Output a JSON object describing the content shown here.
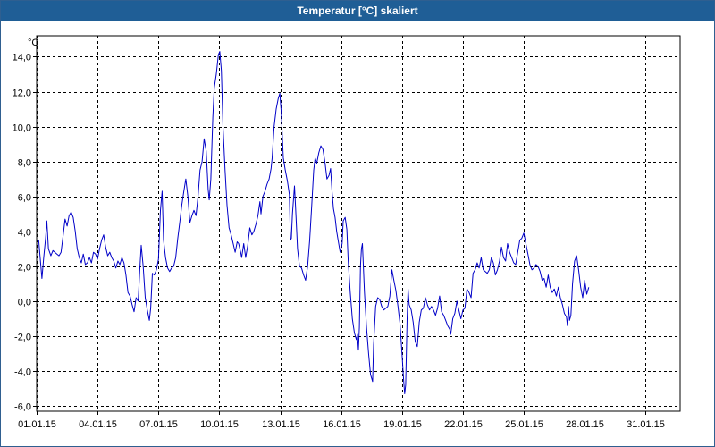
{
  "window": {
    "title": "Temperatur [°C] skaliert"
  },
  "colors": {
    "titlebar": "#1f5e96",
    "series": "#0000c8",
    "grid": "#000000",
    "background": "#ffffff"
  },
  "chart_data": {
    "type": "line",
    "title": "Temperatur [°C] skaliert",
    "ylabel": "°C",
    "xlabel": "",
    "grid": true,
    "legend": "none",
    "xlim": [
      0,
      31.7
    ],
    "ylim": [
      -6.3,
      15.2
    ],
    "x_ticks": [
      {
        "x": 0,
        "label": "01.01.15"
      },
      {
        "x": 3,
        "label": "04.01.15"
      },
      {
        "x": 6,
        "label": "07.01.15"
      },
      {
        "x": 9,
        "label": "10.01.15"
      },
      {
        "x": 12,
        "label": "13.01.15"
      },
      {
        "x": 15,
        "label": "16.01.15"
      },
      {
        "x": 18,
        "label": "19.01.15"
      },
      {
        "x": 21,
        "label": "22.01.15"
      },
      {
        "x": 24,
        "label": "25.01.15"
      },
      {
        "x": 27,
        "label": "28.01.15"
      },
      {
        "x": 30,
        "label": "31.01.15"
      }
    ],
    "y_ticks": [
      {
        "y": -6,
        "label": "-6,0"
      },
      {
        "y": -4,
        "label": "-4,0"
      },
      {
        "y": -2,
        "label": "-2,0"
      },
      {
        "y": 0,
        "label": "0,0"
      },
      {
        "y": 2,
        "label": "2,0"
      },
      {
        "y": 4,
        "label": "4,0"
      },
      {
        "y": 6,
        "label": "6,0"
      },
      {
        "y": 8,
        "label": "8,0"
      },
      {
        "y": 10,
        "label": "10,0"
      },
      {
        "y": 12,
        "label": "12,0"
      },
      {
        "y": 14,
        "label": "14,0"
      }
    ],
    "series": [
      {
        "points": [
          [
            0.0,
            3.5
          ],
          [
            0.1,
            3.5
          ],
          [
            0.17,
            2.5
          ],
          [
            0.26,
            1.3
          ],
          [
            0.35,
            2.5
          ],
          [
            0.44,
            3.6
          ],
          [
            0.5,
            4.6
          ],
          [
            0.58,
            3.0
          ],
          [
            0.7,
            2.6
          ],
          [
            0.8,
            2.9
          ],
          [
            0.9,
            2.8
          ],
          [
            1.0,
            2.7
          ],
          [
            1.1,
            2.6
          ],
          [
            1.2,
            2.8
          ],
          [
            1.3,
            3.7
          ],
          [
            1.4,
            4.7
          ],
          [
            1.5,
            4.3
          ],
          [
            1.6,
            4.9
          ],
          [
            1.7,
            5.1
          ],
          [
            1.8,
            4.8
          ],
          [
            1.9,
            4.0
          ],
          [
            2.0,
            3.0
          ],
          [
            2.1,
            2.5
          ],
          [
            2.2,
            2.2
          ],
          [
            2.3,
            2.7
          ],
          [
            2.4,
            2.1
          ],
          [
            2.5,
            2.2
          ],
          [
            2.6,
            2.5
          ],
          [
            2.7,
            2.2
          ],
          [
            2.8,
            2.8
          ],
          [
            2.9,
            2.7
          ],
          [
            3.0,
            2.4
          ],
          [
            3.1,
            3.0
          ],
          [
            3.2,
            3.5
          ],
          [
            3.3,
            3.8
          ],
          [
            3.4,
            3.1
          ],
          [
            3.5,
            2.6
          ],
          [
            3.6,
            2.8
          ],
          [
            3.7,
            2.5
          ],
          [
            3.8,
            2.3
          ],
          [
            3.9,
            1.9
          ],
          [
            4.0,
            2.3
          ],
          [
            4.1,
            2.1
          ],
          [
            4.2,
            2.5
          ],
          [
            4.3,
            2.2
          ],
          [
            4.4,
            1.5
          ],
          [
            4.5,
            0.5
          ],
          [
            4.6,
            0.3
          ],
          [
            4.7,
            -0.2
          ],
          [
            4.8,
            -0.6
          ],
          [
            4.9,
            0.2
          ],
          [
            5.0,
            0.0
          ],
          [
            5.08,
            1.8
          ],
          [
            5.15,
            3.2
          ],
          [
            5.25,
            2.0
          ],
          [
            5.35,
            0.2
          ],
          [
            5.45,
            -0.5
          ],
          [
            5.55,
            -1.1
          ],
          [
            5.62,
            -0.4
          ],
          [
            5.7,
            1.6
          ],
          [
            5.8,
            1.5
          ],
          [
            5.9,
            1.8
          ],
          [
            6.0,
            2.4
          ],
          [
            6.1,
            5.2
          ],
          [
            6.18,
            6.3
          ],
          [
            6.25,
            3.5
          ],
          [
            6.35,
            2.5
          ],
          [
            6.45,
            1.9
          ],
          [
            6.55,
            1.7
          ],
          [
            6.65,
            1.9
          ],
          [
            6.75,
            2.0
          ],
          [
            6.85,
            2.5
          ],
          [
            6.95,
            3.6
          ],
          [
            7.05,
            4.5
          ],
          [
            7.15,
            5.5
          ],
          [
            7.25,
            6.3
          ],
          [
            7.35,
            7.0
          ],
          [
            7.45,
            6.0
          ],
          [
            7.55,
            4.5
          ],
          [
            7.65,
            4.9
          ],
          [
            7.75,
            5.2
          ],
          [
            7.85,
            4.9
          ],
          [
            7.95,
            6.0
          ],
          [
            8.05,
            7.5
          ],
          [
            8.15,
            8.0
          ],
          [
            8.25,
            9.3
          ],
          [
            8.35,
            8.6
          ],
          [
            8.45,
            6.4
          ],
          [
            8.5,
            5.8
          ],
          [
            8.58,
            7.0
          ],
          [
            8.68,
            10.5
          ],
          [
            8.75,
            12.2
          ],
          [
            8.85,
            13.0
          ],
          [
            8.95,
            14.1
          ],
          [
            9.02,
            14.3
          ],
          [
            9.1,
            13.2
          ],
          [
            9.18,
            10.0
          ],
          [
            9.28,
            7.5
          ],
          [
            9.38,
            5.5
          ],
          [
            9.48,
            4.2
          ],
          [
            9.58,
            3.8
          ],
          [
            9.68,
            3.3
          ],
          [
            9.78,
            2.8
          ],
          [
            9.88,
            3.4
          ],
          [
            9.95,
            3.3
          ],
          [
            10.05,
            2.8
          ],
          [
            10.1,
            2.5
          ],
          [
            10.2,
            3.3
          ],
          [
            10.3,
            2.5
          ],
          [
            10.4,
            3.2
          ],
          [
            10.5,
            4.2
          ],
          [
            10.6,
            3.8
          ],
          [
            10.7,
            4.0
          ],
          [
            10.8,
            4.4
          ],
          [
            10.9,
            4.9
          ],
          [
            11.0,
            5.7
          ],
          [
            11.05,
            5.0
          ],
          [
            11.15,
            6.0
          ],
          [
            11.25,
            6.3
          ],
          [
            11.35,
            6.7
          ],
          [
            11.45,
            7.0
          ],
          [
            11.55,
            7.6
          ],
          [
            11.6,
            8.2
          ],
          [
            11.7,
            10.0
          ],
          [
            11.8,
            11.0
          ],
          [
            11.9,
            11.6
          ],
          [
            11.98,
            11.9
          ],
          [
            12.05,
            10.8
          ],
          [
            12.15,
            8.2
          ],
          [
            12.25,
            7.5
          ],
          [
            12.35,
            6.9
          ],
          [
            12.45,
            6.1
          ],
          [
            12.5,
            3.5
          ],
          [
            12.55,
            3.6
          ],
          [
            12.6,
            5.0
          ],
          [
            12.7,
            6.6
          ],
          [
            12.75,
            5.5
          ],
          [
            12.85,
            3.0
          ],
          [
            12.95,
            2.0
          ],
          [
            13.05,
            1.9
          ],
          [
            13.15,
            1.5
          ],
          [
            13.25,
            1.2
          ],
          [
            13.35,
            2.0
          ],
          [
            13.45,
            3.5
          ],
          [
            13.55,
            5.5
          ],
          [
            13.65,
            7.5
          ],
          [
            13.72,
            8.2
          ],
          [
            13.8,
            7.9
          ],
          [
            13.9,
            8.5
          ],
          [
            14.0,
            8.9
          ],
          [
            14.1,
            8.7
          ],
          [
            14.2,
            8.0
          ],
          [
            14.3,
            7.0
          ],
          [
            14.4,
            7.2
          ],
          [
            14.48,
            7.6
          ],
          [
            14.55,
            6.3
          ],
          [
            14.62,
            5.3
          ],
          [
            14.7,
            4.8
          ],
          [
            14.78,
            4.0
          ],
          [
            14.85,
            3.5
          ],
          [
            14.95,
            2.8
          ],
          [
            15.05,
            3.3
          ],
          [
            15.1,
            4.6
          ],
          [
            15.2,
            4.8
          ],
          [
            15.28,
            4.1
          ],
          [
            15.35,
            2.3
          ],
          [
            15.45,
            0.5
          ],
          [
            15.55,
            -1.0
          ],
          [
            15.65,
            -1.8
          ],
          [
            15.75,
            -2.2
          ],
          [
            15.8,
            -1.9
          ],
          [
            15.85,
            -2.8
          ],
          [
            15.9,
            -1.5
          ],
          [
            15.95,
            2.0
          ],
          [
            16.0,
            3.0
          ],
          [
            16.05,
            3.3
          ],
          [
            16.15,
            0.5
          ],
          [
            16.25,
            -1.5
          ],
          [
            16.35,
            -3.0
          ],
          [
            16.45,
            -4.2
          ],
          [
            16.55,
            -4.6
          ],
          [
            16.6,
            -2.5
          ],
          [
            16.7,
            -0.3
          ],
          [
            16.8,
            0.2
          ],
          [
            16.9,
            0.1
          ],
          [
            17.0,
            -0.3
          ],
          [
            17.1,
            -0.5
          ],
          [
            17.2,
            -0.4
          ],
          [
            17.3,
            -0.3
          ],
          [
            17.4,
            0.3
          ],
          [
            17.5,
            1.8
          ],
          [
            17.6,
            1.2
          ],
          [
            17.7,
            0.6
          ],
          [
            17.8,
            -0.3
          ],
          [
            17.9,
            -1.3
          ],
          [
            18.0,
            -3.0
          ],
          [
            18.08,
            -4.5
          ],
          [
            18.13,
            -5.3
          ],
          [
            18.18,
            -4.8
          ],
          [
            18.25,
            -1.0
          ],
          [
            18.3,
            0.7
          ],
          [
            18.35,
            -0.2
          ],
          [
            18.45,
            -0.5
          ],
          [
            18.55,
            -1.2
          ],
          [
            18.65,
            -2.3
          ],
          [
            18.75,
            -2.6
          ],
          [
            18.85,
            -1.2
          ],
          [
            18.95,
            -0.5
          ],
          [
            19.05,
            -0.4
          ],
          [
            19.15,
            0.2
          ],
          [
            19.25,
            -0.2
          ],
          [
            19.35,
            -0.5
          ],
          [
            19.45,
            -0.3
          ],
          [
            19.55,
            -0.5
          ],
          [
            19.65,
            -0.8
          ],
          [
            19.75,
            -0.4
          ],
          [
            19.85,
            0.3
          ],
          [
            19.95,
            -0.6
          ],
          [
            20.05,
            -0.8
          ],
          [
            20.15,
            -1.1
          ],
          [
            20.25,
            -1.4
          ],
          [
            20.35,
            -1.6
          ],
          [
            20.4,
            -1.9
          ],
          [
            20.5,
            -1.0
          ],
          [
            20.6,
            -0.7
          ],
          [
            20.7,
            0.0
          ],
          [
            20.8,
            -0.5
          ],
          [
            20.9,
            -1.0
          ],
          [
            21.0,
            -0.5
          ],
          [
            21.1,
            -0.4
          ],
          [
            21.2,
            0.7
          ],
          [
            21.3,
            0.5
          ],
          [
            21.4,
            0.2
          ],
          [
            21.5,
            1.6
          ],
          [
            21.6,
            1.8
          ],
          [
            21.7,
            2.2
          ],
          [
            21.8,
            1.9
          ],
          [
            21.9,
            2.5
          ],
          [
            22.0,
            1.8
          ],
          [
            22.1,
            1.7
          ],
          [
            22.2,
            1.6
          ],
          [
            22.3,
            1.8
          ],
          [
            22.4,
            2.5
          ],
          [
            22.5,
            2.2
          ],
          [
            22.6,
            1.5
          ],
          [
            22.7,
            1.8
          ],
          [
            22.8,
            2.3
          ],
          [
            22.9,
            3.1
          ],
          [
            23.0,
            2.5
          ],
          [
            23.1,
            2.3
          ],
          [
            23.2,
            3.3
          ],
          [
            23.3,
            2.8
          ],
          [
            23.4,
            2.5
          ],
          [
            23.5,
            2.2
          ],
          [
            23.6,
            2.1
          ],
          [
            23.7,
            2.8
          ],
          [
            23.8,
            3.5
          ],
          [
            23.9,
            3.6
          ],
          [
            24.0,
            3.9
          ],
          [
            24.1,
            3.3
          ],
          [
            24.2,
            2.7
          ],
          [
            24.3,
            2.1
          ],
          [
            24.4,
            1.8
          ],
          [
            24.5,
            1.9
          ],
          [
            24.6,
            2.1
          ],
          [
            24.7,
            2.0
          ],
          [
            24.8,
            1.7
          ],
          [
            24.9,
            1.2
          ],
          [
            25.0,
            1.3
          ],
          [
            25.1,
            0.8
          ],
          [
            25.2,
            1.5
          ],
          [
            25.3,
            0.8
          ],
          [
            25.4,
            0.5
          ],
          [
            25.5,
            0.7
          ],
          [
            25.6,
            0.3
          ],
          [
            25.7,
            0.8
          ],
          [
            25.8,
            0.2
          ],
          [
            25.9,
            -0.2
          ],
          [
            26.0,
            -0.7
          ],
          [
            26.1,
            -0.9
          ],
          [
            26.15,
            -1.4
          ],
          [
            26.2,
            -0.3
          ],
          [
            26.25,
            -1.1
          ],
          [
            26.32,
            -0.8
          ],
          [
            26.4,
            1.0
          ],
          [
            26.5,
            2.3
          ],
          [
            26.6,
            2.6
          ],
          [
            26.7,
            1.8
          ],
          [
            26.8,
            0.8
          ],
          [
            26.9,
            0.2
          ],
          [
            27.0,
            1.2
          ],
          [
            27.1,
            0.4
          ],
          [
            27.2,
            0.8
          ]
        ]
      }
    ]
  }
}
